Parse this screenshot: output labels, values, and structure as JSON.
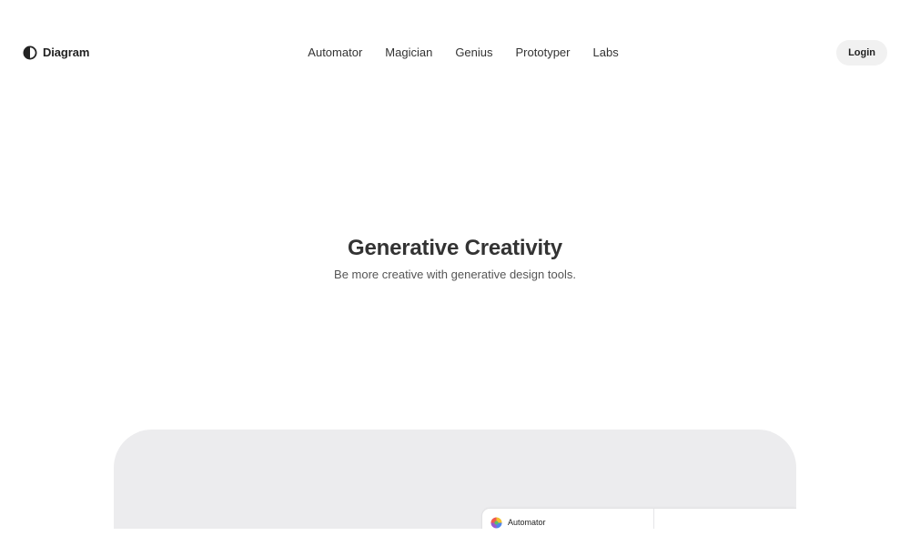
{
  "brand": {
    "name": "Diagram",
    "icon": "half-circle-logo-icon"
  },
  "nav": {
    "items": [
      {
        "label": "Automator"
      },
      {
        "label": "Magician"
      },
      {
        "label": "Genius"
      },
      {
        "label": "Prototyper"
      },
      {
        "label": "Labs"
      }
    ]
  },
  "header": {
    "login_label": "Login"
  },
  "hero": {
    "title": "Generative Creativity",
    "subtitle": "Be more creative with generative design tools."
  },
  "preview": {
    "app_tab_label": "Automator",
    "app_icon": "rainbow-sphere-icon"
  },
  "colors": {
    "background": "#ffffff",
    "text": "#222222",
    "login_bg": "#f1f1f1",
    "preview_bg": "#ececee"
  }
}
